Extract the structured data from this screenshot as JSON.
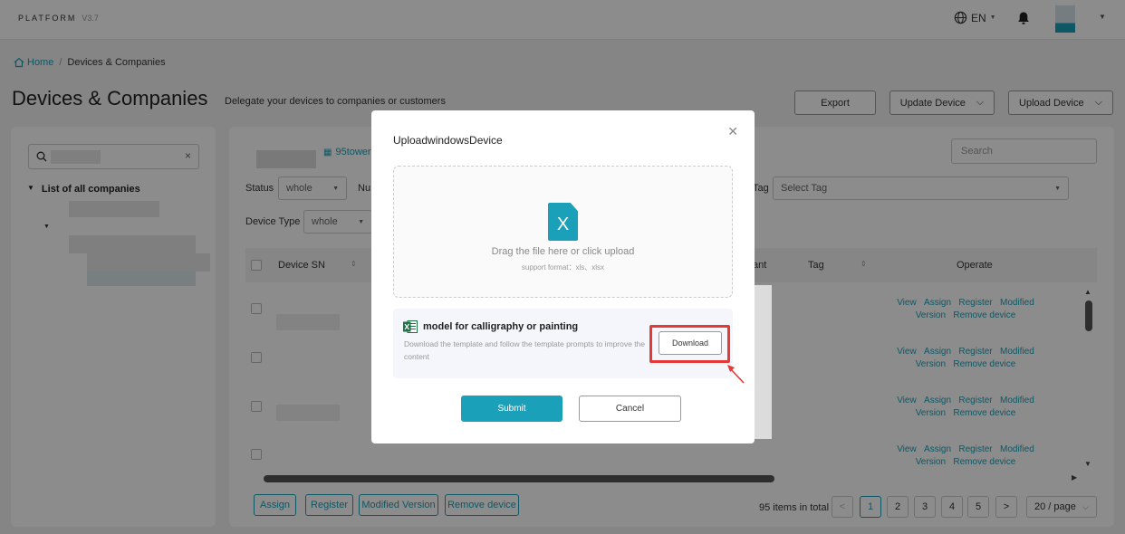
{
  "header": {
    "logo": "PLATFORM",
    "version": "V3.7",
    "language": "EN"
  },
  "breadcrumb": {
    "home": "Home",
    "current": "Devices & Companies"
  },
  "page": {
    "title": "Devices & Companies",
    "subtitle": "Delegate your devices to companies or customers"
  },
  "actions": {
    "export": "Export",
    "update_device": "Update Device",
    "upload_device": "Upload Device"
  },
  "sidebar": {
    "search_value": "",
    "tree_title": "List of all companies"
  },
  "main": {
    "company_link": "95tower",
    "search_placeholder": "Search",
    "status_label": "Status",
    "status_value": "whole",
    "num_label": "Nu",
    "tag_label": "Tag",
    "tag_placeholder": "Select Tag",
    "device_type_label": "Device Type",
    "device_type_value": "whole",
    "columns": {
      "device_sn": "Device SN",
      "tenant": "ant",
      "tag": "Tag",
      "operate": "Operate"
    },
    "row_ops": {
      "view": "View",
      "assign": "Assign",
      "register": "Register",
      "modified": "Modified",
      "version": "Version",
      "remove": "Remove device"
    }
  },
  "bulk": {
    "assign": "Assign",
    "register": "Register",
    "modified_version": "Modified Version",
    "remove_device": "Remove device"
  },
  "pagination": {
    "total": "95 items in total",
    "pages": [
      "1",
      "2",
      "3",
      "4",
      "5"
    ],
    "page_size": "20 / page"
  },
  "modal": {
    "title": "UploadwindowsDevice",
    "drop_text": "Drag the file here or click upload",
    "format_text": "support format：xls、xlsx",
    "template_title": "model for calligraphy or painting",
    "template_desc": "Download the template and follow the template prompts to improve the content",
    "download": "Download",
    "submit": "Submit",
    "cancel": "Cancel"
  },
  "colors": {
    "accent": "#1aa0b8",
    "highlight": "#e53935"
  }
}
